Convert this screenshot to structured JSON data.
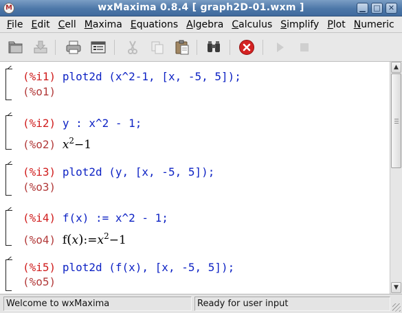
{
  "window": {
    "title": "wxMaxima 0.8.4  [ graph2D-01.wxm ]",
    "icon_letter": "M",
    "minimize_glyph": "▁",
    "maximize_glyph": "□",
    "close_glyph": "✕"
  },
  "menu": {
    "items": [
      {
        "mnemonic": "F",
        "rest": "ile"
      },
      {
        "mnemonic": "E",
        "rest": "dit"
      },
      {
        "mnemonic": "C",
        "rest": "ell"
      },
      {
        "mnemonic": "M",
        "rest": "axima"
      },
      {
        "mnemonic": "E",
        "rest": "quations"
      },
      {
        "mnemonic": "A",
        "rest": "lgebra"
      },
      {
        "mnemonic": "C",
        "rest": "alculus"
      },
      {
        "mnemonic": "S",
        "rest": "implify"
      },
      {
        "mnemonic": "P",
        "rest": "lot"
      },
      {
        "mnemonic": "N",
        "rest": "umeric"
      }
    ]
  },
  "toolbar": {
    "icons": [
      "open-folder-icon",
      "save-icon",
      "print-icon",
      "configure-icon",
      "cut-icon",
      "copy-icon",
      "paste-icon",
      "find-icon",
      "interrupt-icon",
      "run-icon",
      "stop-icon"
    ],
    "interrupt_color": "#cc1f1f"
  },
  "worksheet": {
    "cells": [
      {
        "in_label": "(%i1)",
        "input": "plot2d (x^2-1, [x, -5, 5]);",
        "out_label": "(%o1)",
        "output": ""
      },
      {
        "in_label": "(%i2)",
        "input": "y : x^2 - 1;",
        "out_label": "(%o2)",
        "out_var": "x",
        "out_exp": "2",
        "out_rest": "−1"
      },
      {
        "in_label": "(%i3)",
        "input": "plot2d (y, [x, -5, 5]);",
        "out_label": "(%o3)",
        "output": ""
      },
      {
        "in_label": "(%i4)",
        "input": "f(x) := x^2 - 1;",
        "out_label": "(%o4)",
        "out_fn": "f",
        "out_arg": "x",
        "out_assign": ":=",
        "out_var": "x",
        "out_exp": "2",
        "out_rest": "−1"
      },
      {
        "in_label": "(%i5)",
        "input": "plot2d (f(x), [x, -5, 5]);",
        "out_label": "(%o5)",
        "output": ""
      }
    ],
    "colors": {
      "input": "#0d22c4",
      "in_label": "#d01c1c",
      "out_label": "#b23a3a"
    }
  },
  "scrollbar": {
    "up_glyph": "▲",
    "down_glyph": "▼"
  },
  "status": {
    "left": "Welcome to wxMaxima",
    "right": "Ready for user input"
  }
}
